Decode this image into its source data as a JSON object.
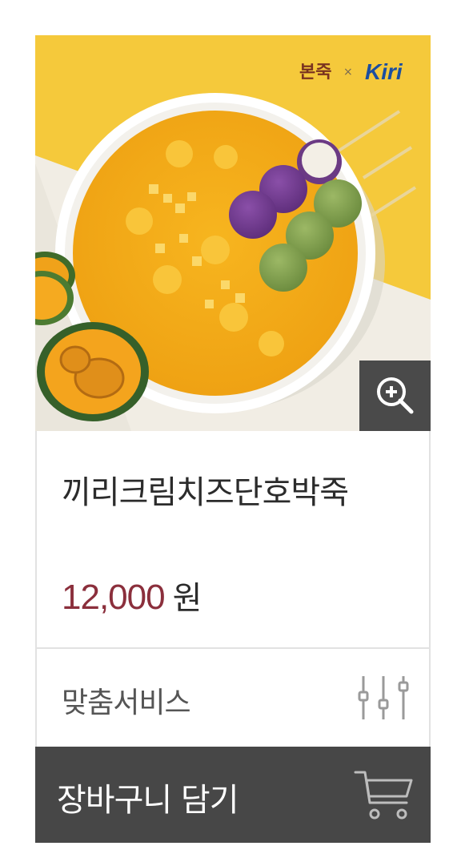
{
  "product": {
    "image_alt": "끼리크림치즈단호박죽",
    "brand_logo": {
      "left": "본죽",
      "separator": "×",
      "right": "Kiri"
    },
    "name": "끼리크림치즈단호박죽",
    "price": "12,000",
    "currency_unit": "원"
  },
  "actions": {
    "zoom_icon": "zoom-in-icon",
    "custom_service_label": "맞춤서비스",
    "custom_service_icon": "sliders-icon",
    "add_to_cart_label": "장바구니 담기",
    "cart_icon": "cart-icon"
  },
  "colors": {
    "price": "#8b2f3c",
    "button_bg": "#474747",
    "zoom_bg": "#4a4a4a",
    "border": "#e2e2e2"
  }
}
